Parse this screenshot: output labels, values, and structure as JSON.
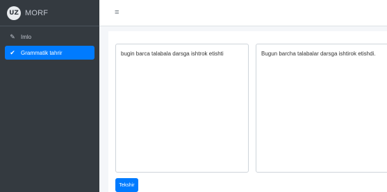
{
  "brand": {
    "logo_text": "UZ",
    "name": "MORF"
  },
  "sidebar": {
    "items": [
      {
        "label": "Imlo",
        "icon": "pencil-icon",
        "active": false
      },
      {
        "label": "Grammatik tahrir",
        "icon": "check-icon",
        "active": true
      }
    ]
  },
  "header": {
    "menu_icon": "hamburger-icon"
  },
  "editor": {
    "input_text": "bugin barca talabala darsga ishtrok etishti",
    "output_text": "Bugun barcha talabalar darsga ishtirok etishdi.",
    "check_button": "Tekshir"
  },
  "colors": {
    "sidebar_bg": "#343a40",
    "accent": "#007bff",
    "page_bg": "#f4f6f9"
  }
}
